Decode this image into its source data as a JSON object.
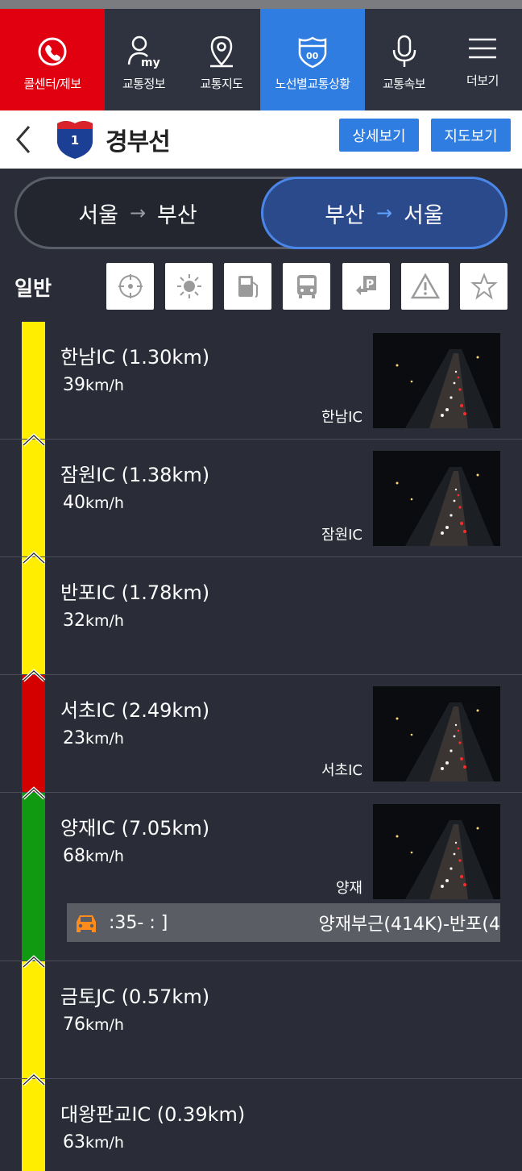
{
  "nav": [
    {
      "label": "콜센터/제보",
      "icon": "phone-icon"
    },
    {
      "label": "교통정보",
      "icon": "my-user-icon"
    },
    {
      "label": "교통지도",
      "icon": "map-pin-icon"
    },
    {
      "label": "노선별교통상황",
      "icon": "highway-shield-icon"
    },
    {
      "label": "교통속보",
      "icon": "microphone-icon"
    },
    {
      "label": "더보기",
      "icon": "menu-icon"
    }
  ],
  "route": {
    "number": "1",
    "name": "경부선",
    "detail_btn": "상세보기",
    "map_btn": "지도보기"
  },
  "direction": {
    "option1": {
      "from": "서울",
      "to": "부산"
    },
    "option2": {
      "from": "부산",
      "to": "서울"
    },
    "arrow": "→",
    "selected": "option2"
  },
  "filter": {
    "label": "일반",
    "icons": [
      "location-target-icon",
      "weather-sun-icon",
      "gas-station-icon",
      "bus-icon",
      "parking-icon",
      "warning-icon",
      "star-icon"
    ]
  },
  "colors": {
    "yellow": "#ffee00",
    "red": "#d40000",
    "green": "#0f9a12",
    "accent": "#2f7de0"
  },
  "segments": [
    {
      "name": "한남IC (1.30km)",
      "speed": "39",
      "unit": "km/h",
      "status": "yellow",
      "cam_label": "한남IC",
      "has_cam": true
    },
    {
      "name": "잠원IC (1.38km)",
      "speed": "40",
      "unit": "km/h",
      "status": "yellow",
      "cam_label": "잠원IC",
      "has_cam": true
    },
    {
      "name": "반포IC (1.78km)",
      "speed": "32",
      "unit": "km/h",
      "status": "yellow",
      "cam_label": "",
      "has_cam": false
    },
    {
      "name": "서초IC (2.49km)",
      "speed": "23",
      "unit": "km/h",
      "status": "red",
      "cam_label": "서초IC",
      "has_cam": true
    },
    {
      "name": "양재IC (7.05km)",
      "speed": "68",
      "unit": "km/h",
      "status": "green",
      "cam_label": "양재",
      "has_cam": true
    },
    {
      "name": "금토JC (0.57km)",
      "speed": "76",
      "unit": "km/h",
      "status": "yellow",
      "cam_label": "",
      "has_cam": false
    },
    {
      "name": "대왕판교IC (0.39km)",
      "speed": "63",
      "unit": "km/h",
      "status": "yellow",
      "cam_label": "",
      "has_cam": false
    }
  ],
  "incident": {
    "time": ":35-  : ]",
    "text": "양재부근(414K)-반포(4"
  }
}
